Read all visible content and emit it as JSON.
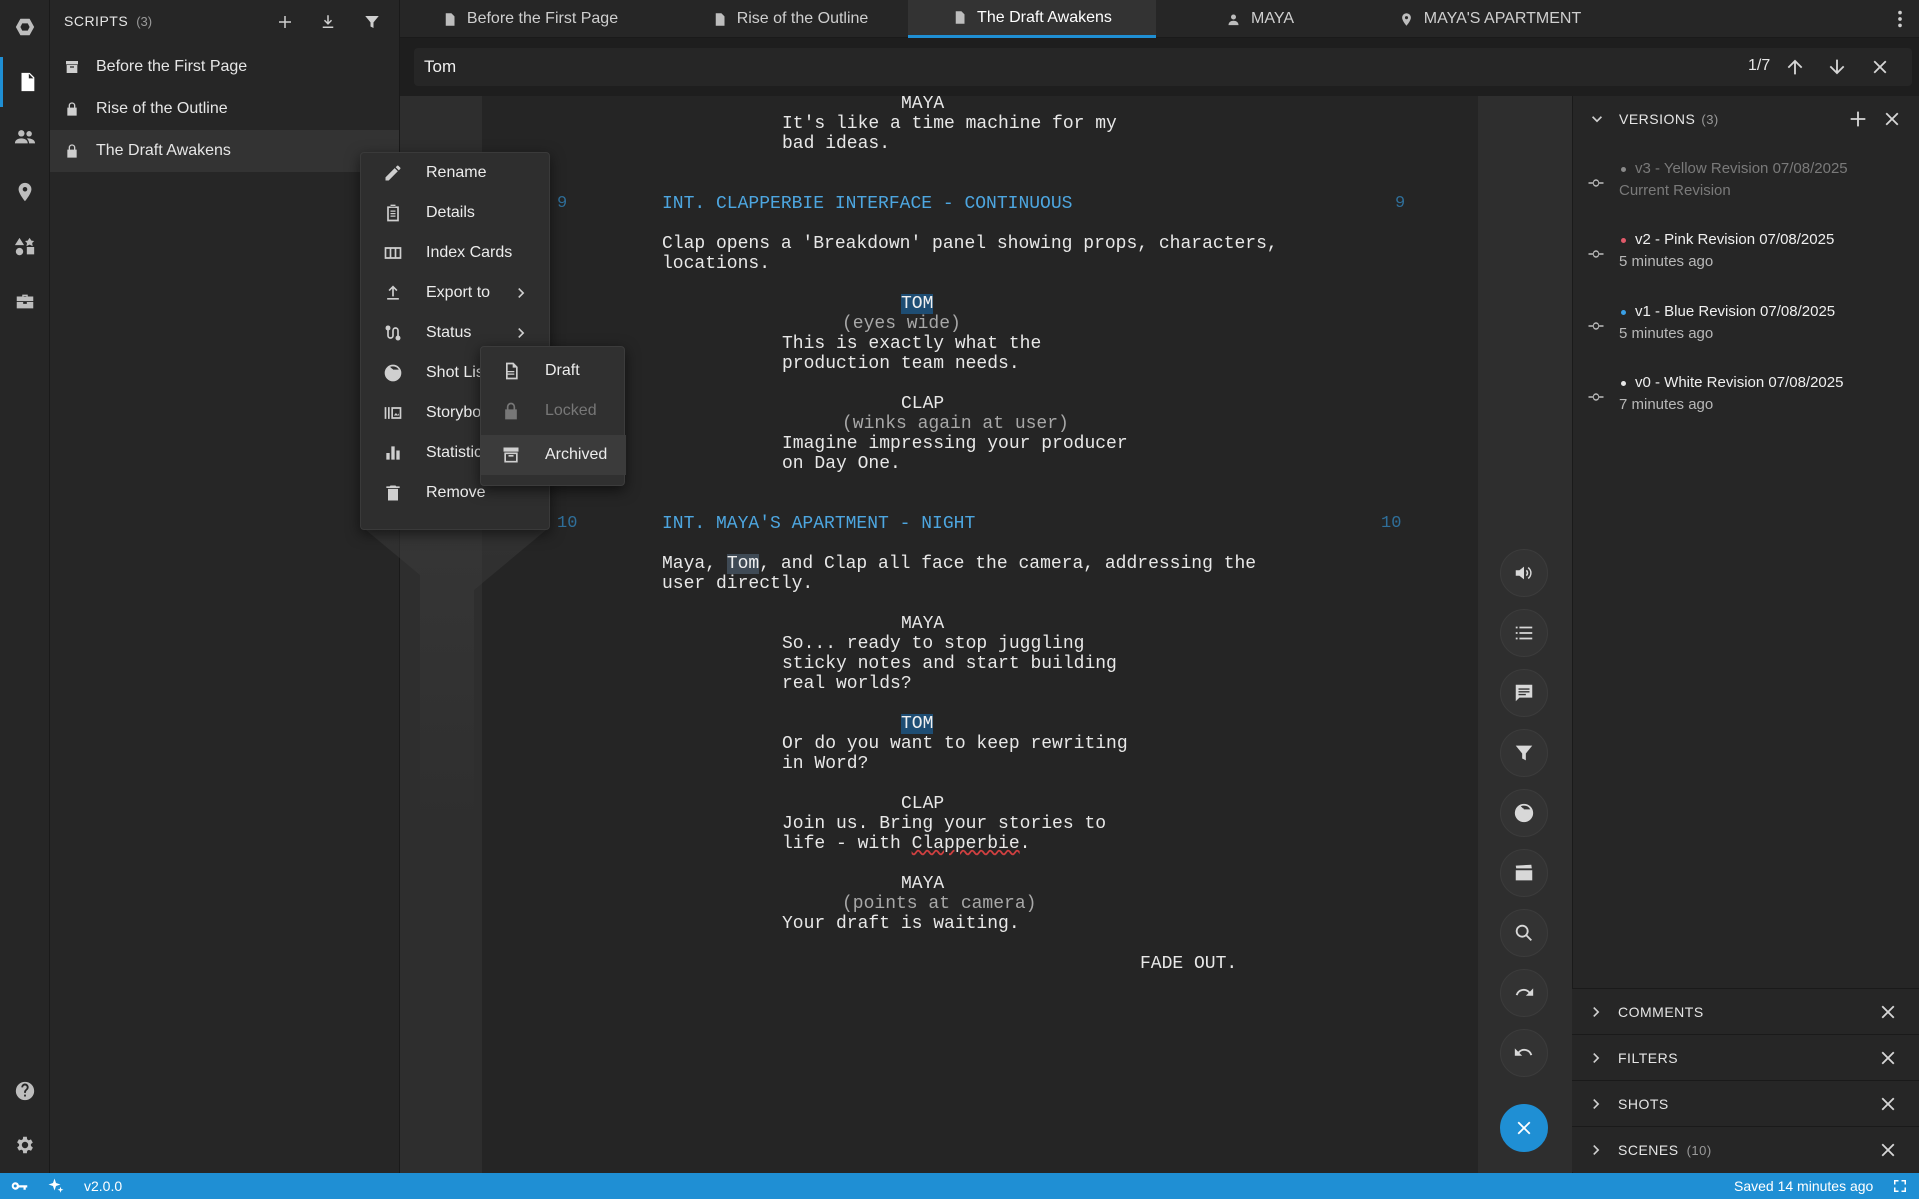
{
  "colors": {
    "accent": "#1f8fd4",
    "heading": "#4da6e0",
    "dot_pink": "#e05a6a",
    "dot_blue": "#3aa0e6",
    "dot_white": "#e6e6e6",
    "dot_yellow": "#8a8a8a"
  },
  "sidebar": {
    "icons": [
      "logo-icon",
      "script-icon",
      "people-icon",
      "location-icon",
      "shapes-icon",
      "briefcase-icon",
      "help-icon",
      "settings-icon"
    ]
  },
  "scripts": {
    "title": "SCRIPTS",
    "count": "(3)",
    "items": [
      {
        "label": "Before the First Page",
        "icon": "archive-icon"
      },
      {
        "label": "Rise of the Outline",
        "icon": "lock-icon"
      },
      {
        "label": "The Draft Awakens",
        "icon": "lock-icon"
      }
    ]
  },
  "tabs": [
    {
      "label": "Before the First Page",
      "icon": "document-icon"
    },
    {
      "label": "Rise of the Outline",
      "icon": "document-icon"
    },
    {
      "label": "The Draft Awakens",
      "icon": "document-icon"
    },
    {
      "label": "MAYA",
      "icon": "person-icon"
    },
    {
      "label": "MAYA'S APARTMENT",
      "icon": "location-icon"
    }
  ],
  "search": {
    "value": "Tom",
    "count": "1/7"
  },
  "script": {
    "lines": [
      {
        "text": "MAYA"
      },
      {
        "text": "It's like a time machine for my"
      },
      {
        "text": "bad ideas."
      },
      {
        "text": "INT. CLAPPERBIE INTERFACE - CONTINUOUS"
      },
      {
        "text": "Clap opens a 'Breakdown' panel showing props, characters,"
      },
      {
        "text": "locations."
      },
      {
        "text": "TOM"
      },
      {
        "text": "(eyes wide)"
      },
      {
        "text": "This is exactly what the"
      },
      {
        "text": "production team needs."
      },
      {
        "text": "CLAP"
      },
      {
        "text": "(winks again at user)"
      },
      {
        "text": "Imagine impressing your producer"
      },
      {
        "text": "on Day One."
      },
      {
        "text": "INT. MAYA'S APARTMENT - NIGHT"
      },
      {
        "text": "Maya, "
      },
      {
        "text": "Tom"
      },
      {
        "text": ", and Clap all face the camera, addressing the"
      },
      {
        "text": "user directly."
      },
      {
        "text": "MAYA"
      },
      {
        "text": "So... ready to stop juggling"
      },
      {
        "text": "sticky notes and start building"
      },
      {
        "text": "real worlds?"
      },
      {
        "text": "TOM"
      },
      {
        "text": "Or do you want to keep rewriting"
      },
      {
        "text": "in Word?"
      },
      {
        "text": "CLAP"
      },
      {
        "text": "Join us. Bring your stories to"
      },
      {
        "text": "life - with "
      },
      {
        "text": "Clapperbie"
      },
      {
        "text": "."
      },
      {
        "text": "MAYA"
      },
      {
        "text": "(points at camera)"
      },
      {
        "text": "Your draft is waiting."
      },
      {
        "text": "FADE OUT."
      }
    ],
    "scene_numbers": [
      "9",
      "9",
      "10",
      "10"
    ]
  },
  "context_menu": {
    "items": [
      "Rename",
      "Details",
      "Index Cards",
      "Export to",
      "Status",
      "Shot List",
      "Storyboard",
      "Statistics",
      "Remove"
    ]
  },
  "status_submenu": {
    "items": [
      "Draft",
      "Locked",
      "Archived"
    ]
  },
  "versions": {
    "title": "VERSIONS",
    "count": "(3)",
    "items": [
      {
        "name": "v3 - Yellow Revision 07/08/2025",
        "sub": "Current Revision"
      },
      {
        "name": "v2 - Pink Revision 07/08/2025",
        "sub": "5 minutes ago"
      },
      {
        "name": "v1 - Blue Revision 07/08/2025",
        "sub": "5 minutes ago"
      },
      {
        "name": "v0 - White Revision 07/08/2025",
        "sub": "7 minutes ago"
      }
    ]
  },
  "sections": [
    {
      "title": "COMMENTS",
      "count": ""
    },
    {
      "title": "FILTERS",
      "count": ""
    },
    {
      "title": "SHOTS",
      "count": ""
    },
    {
      "title": "SCENES",
      "count": "(10)"
    }
  ],
  "statusbar": {
    "version": "v2.0.0",
    "saved": "Saved 14 minutes ago"
  }
}
